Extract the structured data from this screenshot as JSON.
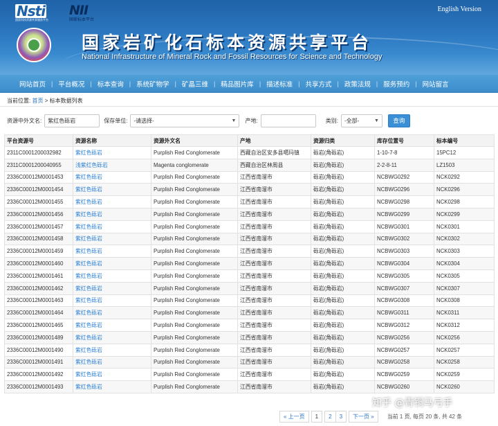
{
  "header": {
    "logo_nsti_mark": "Nsti",
    "logo_nsti_sub": "国家科技资源共享服务平台",
    "logo_nii_mark": "NII",
    "logo_nii_sub": "国家标本平台",
    "english_link": "English Version",
    "title_cn": "国家岩矿化石标本资源共享平台",
    "title_en": "National Infrastructure of Mineral Rock and Fossil Resources for Science and Technology"
  },
  "nav": [
    "网站首页",
    "平台概况",
    "标本查询",
    "系统矿物学",
    "矿晶三维",
    "精品图片库",
    "描述标准",
    "共享方式",
    "政策法规",
    "服务预约",
    "网站留言"
  ],
  "breadcrumb": {
    "label": "当前位置:",
    "home": "首页",
    "sep": " > ",
    "current": "标本数据列表"
  },
  "filters": {
    "name_label": "资源中外文名:",
    "name_value": "紫红色砾岩",
    "unit_label": "保存单位:",
    "unit_value": "-请选择-",
    "origin_label": "产地:",
    "origin_value": "",
    "category_label": "类别:",
    "category_value": "-全部-",
    "query_button": "查询"
  },
  "table": {
    "headers": [
      "平台资源号",
      "资源名称",
      "资源外文名",
      "产地",
      "资源归类",
      "库存位置号",
      "标本编号"
    ],
    "rows": [
      [
        "2311C0001200032982",
        "紫红色砾岩",
        "Purplish Red Conglomerate",
        "西藏自治区安多县噶玛镇",
        "砾岩(角砾岩)",
        "1-10-7-8",
        "15PC12"
      ],
      [
        "2311C0001200040955",
        "浅紫红色砾岩",
        "Magenta conglomerate",
        "西藏自治区林周县",
        "砾岩(角砾岩)",
        "2-2-8-11",
        "LZ1503"
      ],
      [
        "2336C00012M0001453",
        "紫红色砾岩",
        "Purplish Red Conglomerate",
        "江西省南溜市",
        "砾岩(角砾岩)",
        "NCBWG0292",
        "NCK0292"
      ],
      [
        "2336C00012M0001454",
        "紫红色砾岩",
        "Purplish Red Conglomerate",
        "江西省南溜市",
        "砾岩(角砾岩)",
        "NCBWG0296",
        "NCK0296"
      ],
      [
        "2336C00012M0001455",
        "紫红色砾岩",
        "Purplish Red Conglomerate",
        "江西省南溜市",
        "砾岩(角砾岩)",
        "NCBWG0298",
        "NCK0298"
      ],
      [
        "2336C00012M0001456",
        "紫红色砾岩",
        "Purplish Red Conglomerate",
        "江西省南溜市",
        "砾岩(角砾岩)",
        "NCBWG0299",
        "NCK0299"
      ],
      [
        "2336C00012M0001457",
        "紫红色砾岩",
        "Purplish Red Conglomerate",
        "江西省南溜市",
        "砾岩(角砾岩)",
        "NCBWG0301",
        "NCK0301"
      ],
      [
        "2336C00012M0001458",
        "紫红色砾岩",
        "Purplish Red Conglomerate",
        "江西省南溜市",
        "砾岩(角砾岩)",
        "NCBWG0302",
        "NCK0302"
      ],
      [
        "2336C00012M0001459",
        "紫红色砾岩",
        "Purplish Red Conglomerate",
        "江西省南溜市",
        "砾岩(角砾岩)",
        "NCBWG0303",
        "NCK0303"
      ],
      [
        "2336C00012M0001460",
        "紫红色砾岩",
        "Purplish Red Conglomerate",
        "江西省南溜市",
        "砾岩(角砾岩)",
        "NCBWG0304",
        "NCK0304"
      ],
      [
        "2336C00012M0001461",
        "紫红色砾岩",
        "Purplish Red Conglomerate",
        "江西省南溜市",
        "砾岩(角砾岩)",
        "NCBWG0305",
        "NCK0305"
      ],
      [
        "2336C00012M0001462",
        "紫红色砾岩",
        "Purplish Red Conglomerate",
        "江西省南溜市",
        "砾岩(角砾岩)",
        "NCBWG0307",
        "NCK0307"
      ],
      [
        "2336C00012M0001463",
        "紫红色砾岩",
        "Purplish Red Conglomerate",
        "江西省南溜市",
        "砾岩(角砾岩)",
        "NCBWG0308",
        "NCK0308"
      ],
      [
        "2336C00012M0001464",
        "紫红色砾岩",
        "Purplish Red Conglomerate",
        "江西省南溜市",
        "砾岩(角砾岩)",
        "NCBWG0311",
        "NCK0311"
      ],
      [
        "2336C00012M0001465",
        "紫红色砾岩",
        "Purplish Red Conglomerate",
        "江西省南溜市",
        "砾岩(角砾岩)",
        "NCBWG0312",
        "NCK0312"
      ],
      [
        "2336C00012M0001489",
        "紫红色砾岩",
        "Purplish Red Conglomerate",
        "江西省南溜市",
        "砾岩(角砾岩)",
        "NCBWG0256",
        "NCK0256"
      ],
      [
        "2336C00012M0001490",
        "紫红色砾岩",
        "Purplish Red Conglomerate",
        "江西省南溜市",
        "砾岩(角砾岩)",
        "NCBWG0257",
        "NCK0257"
      ],
      [
        "2336C00012M0001491",
        "紫红色砾岩",
        "Purplish Red Conglomerate",
        "江西省南溜市",
        "砾岩(角砾岩)",
        "NCBWG0258",
        "NCK0258"
      ],
      [
        "2336C00012M0001492",
        "紫红色砾岩",
        "Purplish Red Conglomerate",
        "江西省南溜市",
        "砾岩(角砾岩)",
        "NCBWG0259",
        "NCK0259"
      ],
      [
        "2336C00012M0001493",
        "紫红色砾岩",
        "Purplish Red Conglomerate",
        "江西省南溜市",
        "砾岩(角砾岩)",
        "NCBWG0260",
        "NCK0260"
      ]
    ]
  },
  "pager": {
    "prev": "« 上一页",
    "pages": [
      "1",
      "2",
      "3"
    ],
    "next": "下一页 »",
    "info": "当前 1 页, 每页 20 条, 共 42 条"
  },
  "watermark": "知乎 @青铜马弓手",
  "colors": {
    "banner": "#2c78c0",
    "nav": "#4a98d4",
    "link": "#2a7fd4",
    "button": "#3a8fd6"
  }
}
